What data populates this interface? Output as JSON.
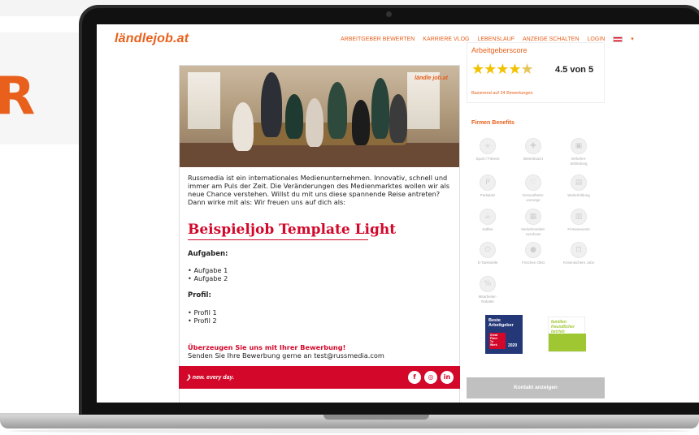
{
  "background": {
    "letter": "R"
  },
  "site": {
    "logo_main": "ländle",
    "logo_accent": "job.at"
  },
  "nav": {
    "items": [
      "ARBEITGEBER BEWERTEN",
      "KARRIERE VLOG",
      "LEBENSLAUF",
      "ANZEIGE SCHALTEN",
      "LOGIN"
    ],
    "flag": "austria-flag-icon"
  },
  "job": {
    "photo_logo": "ländle job.at",
    "intro": "Russmedia ist ein internationales Medienunternehmen. Innovativ, schnell und immer am Puls der Zeit. Die Veränderungen des Medienmarktes wollen wir als neue Chance verstehen. Willst du mit uns diese spannende Reise antreten? Dann wirke mit als: Wir freuen uns auf dich als:",
    "title": "Beispieljob Template Light",
    "tasks_heading": "Aufgaben:",
    "tasks": [
      "Aufgabe 1",
      "Aufgabe 2"
    ],
    "profile_heading": "Profil:",
    "profile": [
      "Profil 1",
      "Profil 2"
    ],
    "cta": "Überzeugen Sie uns mit Ihrer Bewerbung!",
    "cta_text": "Senden Sie Ihre Bewerbung gerne an test@russmedia.com",
    "footer_slogan": "❯ new. every day.",
    "social": [
      "f",
      "◎",
      "in"
    ]
  },
  "score": {
    "title": "Arbeitgeberscore",
    "rating": 4.5,
    "value_text": "4.5 von 5",
    "basis": "Basierend auf 24 Bewertungen"
  },
  "benefits": {
    "title": "Firmen Benefits",
    "items": [
      "Sport / Fitness",
      "Betriebsarzt",
      "Verkehrs-\nanbindung",
      "Parkplatz",
      "Gesundheits-\nvorsorge",
      "Weiterbildung",
      "Kaffee",
      "Verkehrsmittel-\nzuschuss",
      "Firmenevents",
      "E-Tankstelle",
      "Frisches Obst",
      "Krisensichere Jobs",
      "Mitarbeiter-\nRabatte"
    ]
  },
  "badges": {
    "badge1_title": "Beste\nArbeitgeber",
    "badge1_inner": "Great\nPlace\nTo\nWork",
    "badge1_year": "2020",
    "badge2_title": "familien\nfreundlicher\nbetrieb"
  },
  "kontakt_label": "Kontakt anzeigen"
}
